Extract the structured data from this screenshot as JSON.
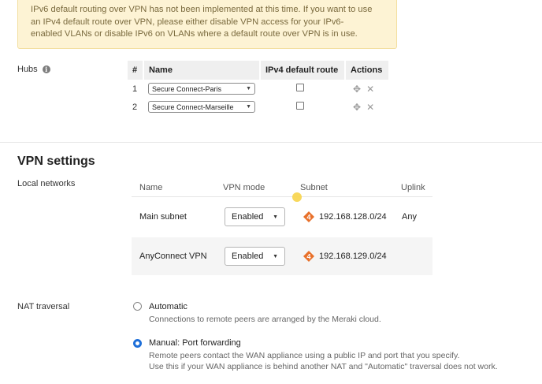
{
  "warning": {
    "line1": "IPv6 default routing over VPN has not been implemented at this time. If you want to use",
    "line2": "an IPv4 default route over VPN, please either disable VPN access for your IPv6-",
    "line3": "enabled VLANs or disable IPv6 on VLANs where a default route over VPN is in use."
  },
  "hubs": {
    "label": "Hubs",
    "columns": [
      "#",
      "Name",
      "IPv4 default route",
      "Actions"
    ],
    "rows": [
      {
        "num": "1",
        "name": "Secure Connect-Paris"
      },
      {
        "num": "2",
        "name": "Secure Connect-Marseille"
      }
    ]
  },
  "vpn_settings": {
    "title": "VPN settings",
    "local_networks_label": "Local networks",
    "columns": [
      "Name",
      "VPN mode",
      "Subnet",
      "Uplink"
    ],
    "rows": [
      {
        "name": "Main subnet",
        "mode": "Enabled",
        "subnet": "192.168.128.0/24",
        "uplink": "Any"
      },
      {
        "name": "AnyConnect VPN",
        "mode": "Enabled",
        "subnet": "192.168.129.0/24",
        "uplink": ""
      }
    ]
  },
  "nat": {
    "label": "NAT traversal",
    "options": [
      {
        "title": "Automatic",
        "desc1": "Connections to remote peers are arranged by the Meraki cloud.",
        "desc2": "",
        "selected": false
      },
      {
        "title": "Manual: Port forwarding",
        "desc1": "Remote peers contact the WAN appliance using a public IP and port that you specify.",
        "desc2": "Use this if your WAN appliance is behind another NAT and \"Automatic\" traversal does not work.",
        "selected": true
      }
    ]
  },
  "colors": {
    "accent": "#1e6fd9",
    "subnet_badge": "#e8702a",
    "warning_bg": "#fdf3d4"
  }
}
